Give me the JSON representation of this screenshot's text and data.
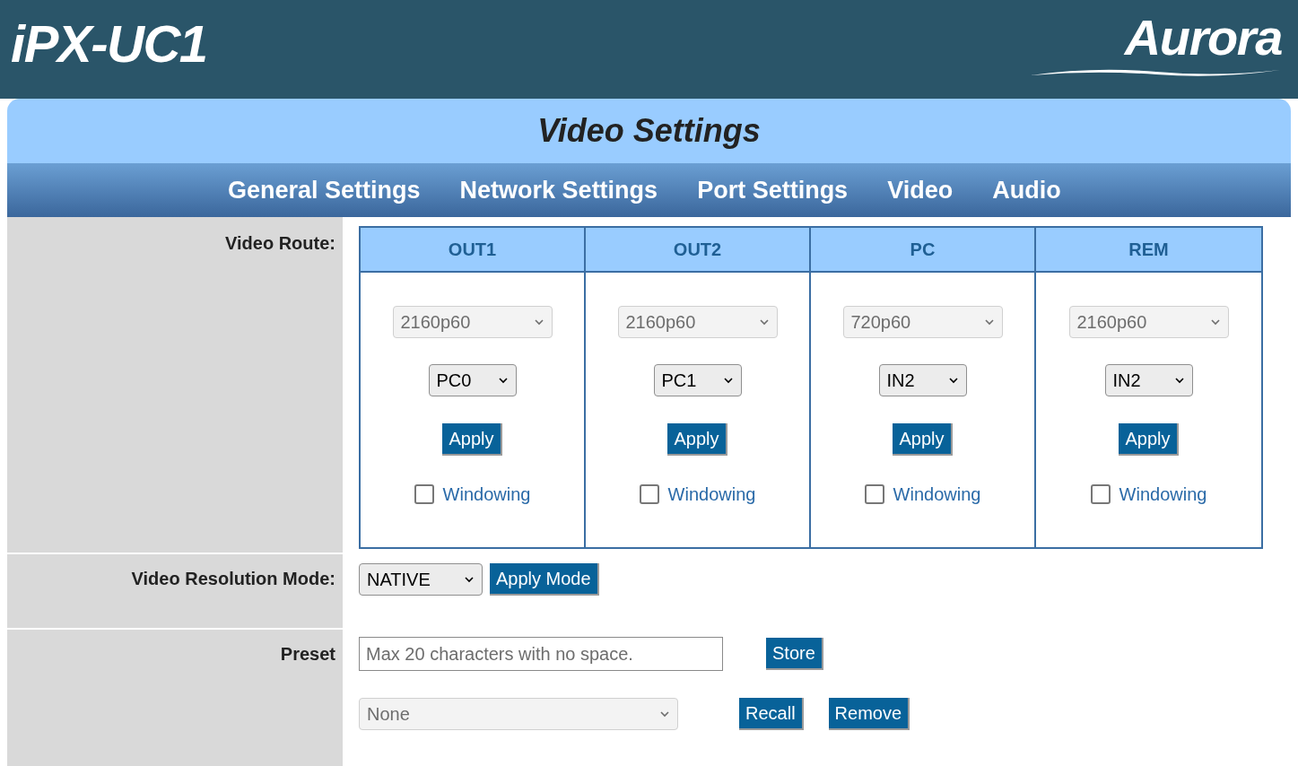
{
  "header": {
    "product": "iPX-UC1",
    "brand": "Aurora"
  },
  "page_title": "Video Settings",
  "nav": [
    {
      "label": "General Settings"
    },
    {
      "label": "Network Settings"
    },
    {
      "label": "Port Settings"
    },
    {
      "label": "Video"
    },
    {
      "label": "Audio"
    }
  ],
  "video_route": {
    "label": "Video Route:",
    "outputs": [
      {
        "name": "OUT1",
        "resolution": "2160p60",
        "resolution_disabled": true,
        "source": "PC0",
        "button": "Apply",
        "windowing": {
          "label": "Windowing",
          "checked": false
        }
      },
      {
        "name": "OUT2",
        "resolution": "2160p60",
        "resolution_disabled": true,
        "source": "PC1",
        "button": "Apply",
        "windowing": {
          "label": "Windowing",
          "checked": false
        }
      },
      {
        "name": "PC",
        "resolution": "720p60",
        "resolution_disabled": true,
        "source": "IN2",
        "button": "Apply",
        "windowing": {
          "label": "Windowing",
          "checked": false
        }
      },
      {
        "name": "REM",
        "resolution": "2160p60",
        "resolution_disabled": true,
        "source": "IN2",
        "button": "Apply",
        "windowing": {
          "label": "Windowing",
          "checked": false
        }
      }
    ]
  },
  "resolution_mode": {
    "label": "Video Resolution Mode:",
    "value": "NATIVE",
    "button": "Apply Mode"
  },
  "preset": {
    "label": "Preset",
    "placeholder": "Max 20 characters with no space.",
    "store_button": "Store",
    "select": {
      "value": "None",
      "disabled": true
    },
    "recall_button": "Recall",
    "remove_button": "Remove"
  }
}
